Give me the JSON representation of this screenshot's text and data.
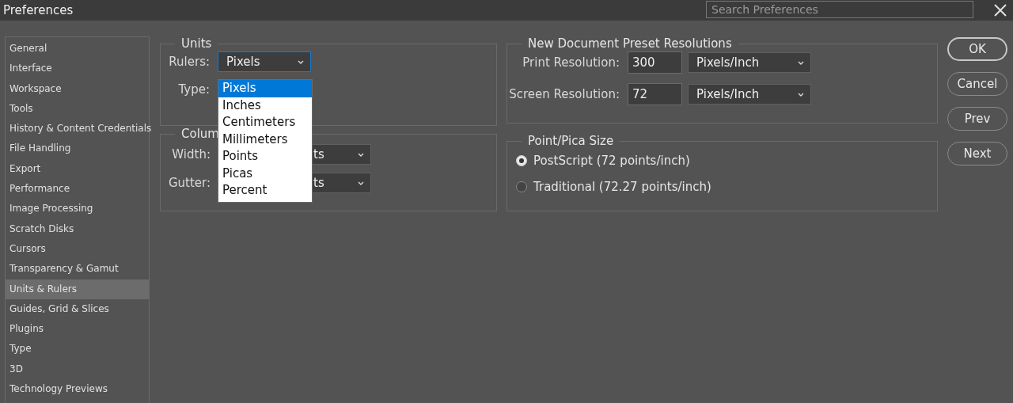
{
  "window": {
    "title": "Preferences"
  },
  "search": {
    "placeholder": "Search Preferences"
  },
  "sidebar": {
    "items": [
      {
        "label": "General",
        "selected": false
      },
      {
        "label": "Interface",
        "selected": false
      },
      {
        "label": "Workspace",
        "selected": false
      },
      {
        "label": "Tools",
        "selected": false
      },
      {
        "label": "History & Content Credentials",
        "selected": false
      },
      {
        "label": "File Handling",
        "selected": false
      },
      {
        "label": "Export",
        "selected": false
      },
      {
        "label": "Performance",
        "selected": false
      },
      {
        "label": "Image Processing",
        "selected": false
      },
      {
        "label": "Scratch Disks",
        "selected": false
      },
      {
        "label": "Cursors",
        "selected": false
      },
      {
        "label": "Transparency & Gamut",
        "selected": false
      },
      {
        "label": "Units & Rulers",
        "selected": true
      },
      {
        "label": "Guides, Grid & Slices",
        "selected": false
      },
      {
        "label": "Plugins",
        "selected": false
      },
      {
        "label": "Type",
        "selected": false
      },
      {
        "label": "3D",
        "selected": false
      },
      {
        "label": "Technology Previews",
        "selected": false
      }
    ]
  },
  "units": {
    "title": "Units",
    "rulers": {
      "label": "Rulers:",
      "value": "Pixels",
      "open": true,
      "options": [
        {
          "label": "Pixels",
          "selected": true
        },
        {
          "label": "Inches",
          "selected": false
        },
        {
          "label": "Centimeters",
          "selected": false
        },
        {
          "label": "Millimeters",
          "selected": false
        },
        {
          "label": "Points",
          "selected": false
        },
        {
          "label": "Picas",
          "selected": false
        },
        {
          "label": "Percent",
          "selected": false
        }
      ]
    },
    "type": {
      "label": "Type:"
    }
  },
  "columns": {
    "title": "Colum",
    "width": {
      "label": "Width:",
      "value": "ts"
    },
    "gutter": {
      "label": "Gutter:",
      "value": "ts"
    }
  },
  "resolutions": {
    "title": "New Document Preset Resolutions",
    "fields": [
      {
        "label": "Print Resolution:",
        "value": "300",
        "unit": "Pixels/Inch"
      },
      {
        "label": "Screen Resolution:",
        "value": "72",
        "unit": "Pixels/Inch"
      }
    ]
  },
  "point_size": {
    "title": "Point/Pica Size",
    "options": [
      {
        "label": "PostScript (72 points/inch)",
        "selected": true
      },
      {
        "label": "Traditional (72.27 points/inch)",
        "selected": false
      }
    ]
  },
  "buttons": [
    {
      "label": "OK",
      "default": true
    },
    {
      "label": "Cancel",
      "default": false
    },
    {
      "label": "Prev",
      "default": false
    },
    {
      "label": "Next",
      "default": false
    }
  ]
}
